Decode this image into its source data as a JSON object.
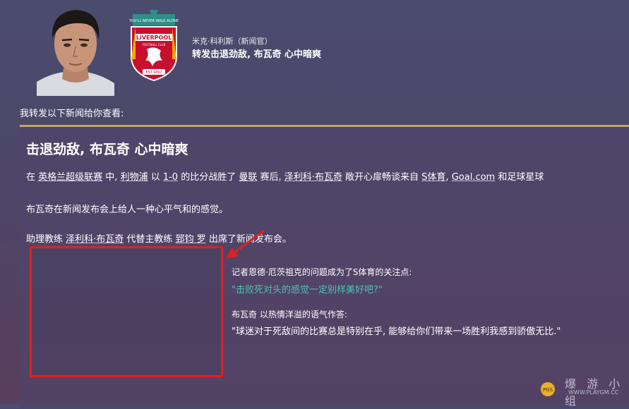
{
  "message": {
    "sender": "米克·科利斯（新闻官）",
    "headline": "转发击退劲敌, 布瓦奇 心中暗爽",
    "intro": "我转发以下新闻给你查看:"
  },
  "article": {
    "title": "击退劲敌, 布瓦奇 心中暗爽",
    "para1": {
      "t1": "在 ",
      "league": "英格兰超级联赛",
      "t2": " 中, ",
      "team_a": "利物浦",
      "t3": " 以 ",
      "score": "1-0",
      "t4": " 的比分战胜了 ",
      "team_b": "曼联",
      "t5": " 赛后, ",
      "coach": "泽利科·布瓦奇",
      "t6": " 敞开心扉畅谈来自 ",
      "media1": "S体育",
      "t7": ", ",
      "media2": "Goal.com",
      "t8": " 和足球星球"
    },
    "para2": "布瓦奇在新闻发布会上给人一种心平气和的感觉。",
    "para3": {
      "t1": "助理教练 ",
      "coach": "泽利科·布瓦奇",
      "t2": " 代替主教练 ",
      "manager": "郅钧 罗",
      "t3": " 出席了新闻发布会。"
    },
    "question_label": "记者恩德·厄茨祖克的问题成为了S体育的关注点:",
    "question": "\"击败死对头的感觉一定别样美好吧?\"",
    "answer_label": "布瓦奇 以热情洋溢的语气作答:",
    "answer": "\"球迷对于死敌间的比赛总是特别在乎, 能够给你们带来一场胜利我感到骄傲无比.\""
  },
  "logo": {
    "club_text": "LIVERPOOL",
    "arc_text": "YOU'LL NEVER WALK ALONE",
    "sub_text": "FOOTBALL CLUB",
    "est_text": "EST.1892"
  },
  "watermark": {
    "text": "爆 游 小 组",
    "url": "WWW.PLAYGM.CC"
  },
  "colors": {
    "accent_gold": "#c9a94a",
    "quote_green": "#4fc3b3",
    "annotation_red": "#e02020",
    "club_red": "#c8102e"
  }
}
